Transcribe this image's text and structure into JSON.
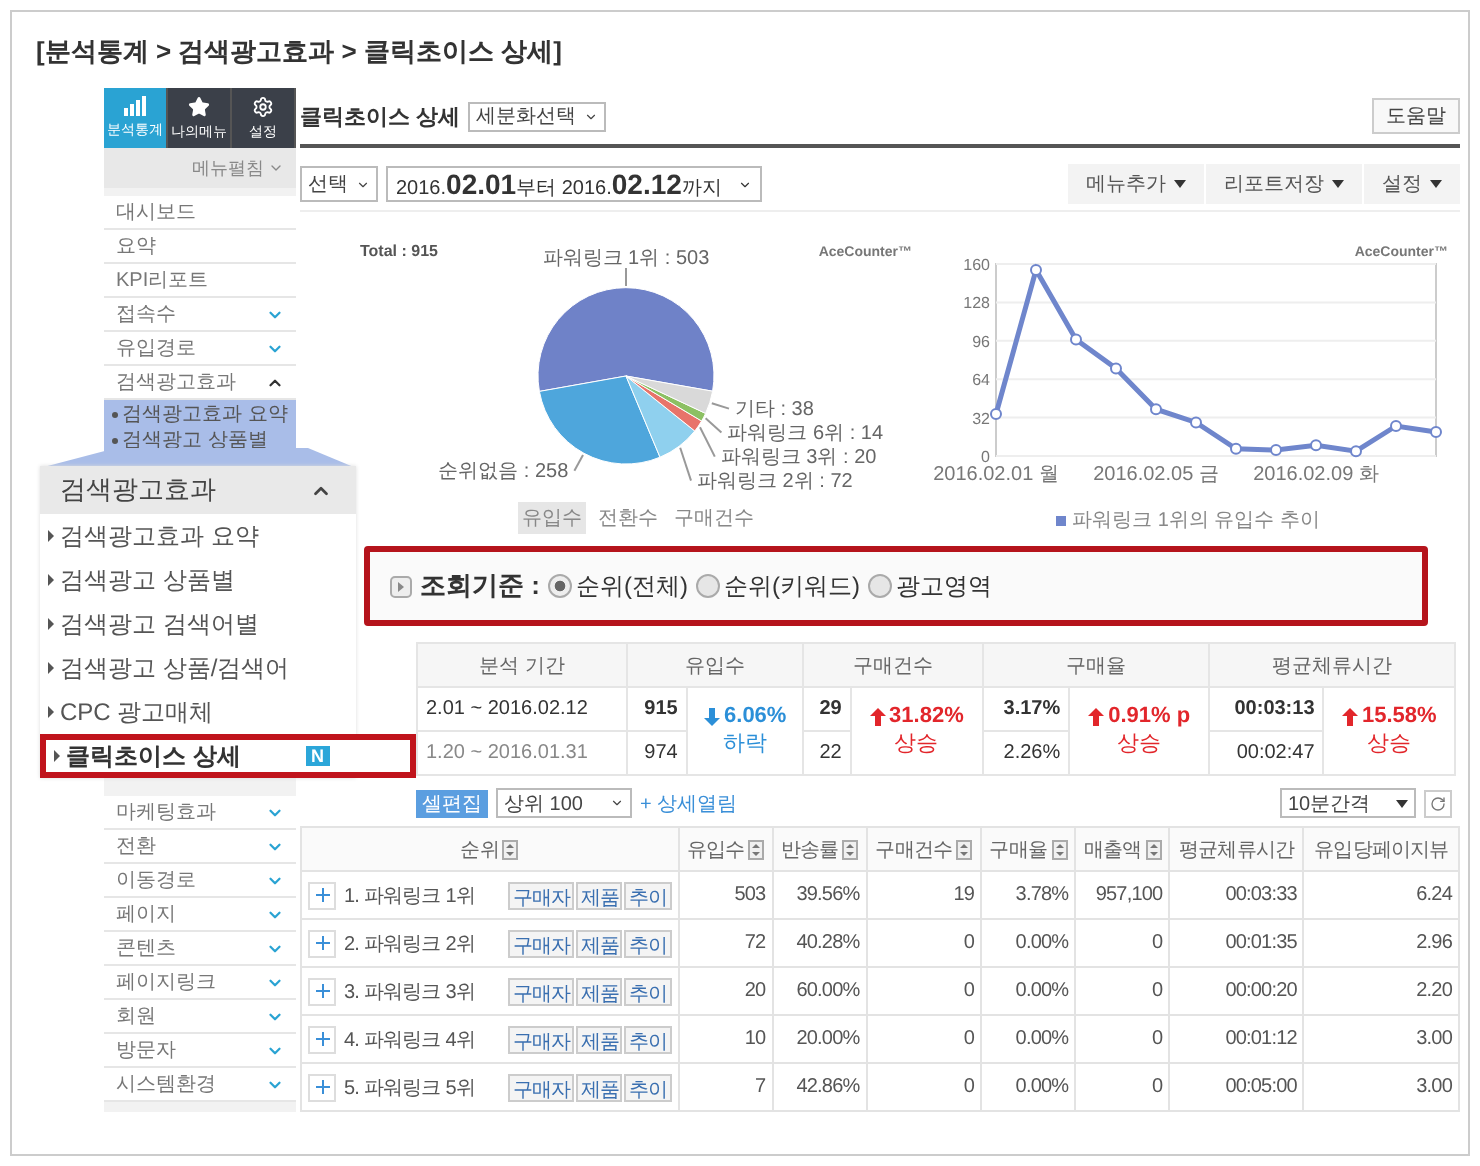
{
  "breadcrumb": "[분석통계 > 검색광고효과 > 클릭초이스 상세]",
  "sidebar": {
    "tabs": [
      {
        "label": "분석통계",
        "selected": true
      },
      {
        "label": "나의메뉴",
        "selected": false
      },
      {
        "label": "설정",
        "selected": false
      }
    ],
    "expand_all": "메뉴펼침",
    "items": [
      {
        "label": "대시보드",
        "kind": "link"
      },
      {
        "label": "요약",
        "kind": "link"
      },
      {
        "label": "KPI리포트",
        "kind": "link"
      },
      {
        "label": "접속수",
        "kind": "group",
        "expanded": false
      },
      {
        "label": "유입경로",
        "kind": "group",
        "expanded": false
      },
      {
        "label": "검색광고효과",
        "kind": "group",
        "expanded": true,
        "children": [
          "검색광고효과 요약",
          "검색광고 상품별"
        ]
      }
    ],
    "lower_items": [
      {
        "label": "마케팅효과",
        "kind": "group",
        "expanded": false
      },
      {
        "label": "전환",
        "kind": "group",
        "expanded": false
      },
      {
        "label": "이동경로",
        "kind": "group",
        "expanded": false
      },
      {
        "label": "페이지",
        "kind": "group",
        "expanded": false
      },
      {
        "label": "콘텐츠",
        "kind": "group",
        "expanded": false
      },
      {
        "label": "페이지링크",
        "kind": "group",
        "expanded": false
      },
      {
        "label": "회원",
        "kind": "group",
        "expanded": false
      },
      {
        "label": "방문자",
        "kind": "group",
        "expanded": false
      },
      {
        "label": "시스템환경",
        "kind": "group",
        "expanded": false
      }
    ]
  },
  "zoom_menu": {
    "title": "검색광고효과",
    "expanded": true,
    "items": [
      {
        "label": "검색광고효과 요약",
        "selected": false
      },
      {
        "label": "검색광고 상품별",
        "selected": false
      },
      {
        "label": "검색광고 검색어별",
        "selected": false
      },
      {
        "label": "검색광고 상품/검색어",
        "selected": false
      },
      {
        "label": "CPC 광고매체",
        "selected": false
      },
      {
        "label": "클릭초이스 상세",
        "selected": true,
        "badge": "N"
      }
    ]
  },
  "header": {
    "title": "클릭초이스 상세",
    "segment_select": "세분화선택",
    "help_button": "도움말"
  },
  "filters": {
    "period_select": "선택",
    "date_range": "2016.**02.01**부터 2016.**02.12**까지"
  },
  "toolbar": [
    "메뉴추가",
    "리포트저장",
    "설정"
  ],
  "pie": {
    "total": "Total : 915",
    "brand": "AceCounter™",
    "chart_data": {
      "type": "pie",
      "categories": [
        "파워링크 1위 : 503",
        "순위없음 : 258",
        "파워링크 2위 : 72",
        "파워링크 3위 : 20",
        "파워링크 6위 : 14",
        "기타 : 38"
      ],
      "values": [
        503,
        258,
        72,
        20,
        14,
        38
      ]
    },
    "metric_tabs": [
      {
        "label": "유입수",
        "selected": true
      },
      {
        "label": "전환수",
        "selected": false
      },
      {
        "label": "구매건수",
        "selected": false
      }
    ]
  },
  "line": {
    "brand": "AceCounter™",
    "chart_data": {
      "type": "line",
      "categories": [
        "2016.02.01 월",
        null,
        null,
        null,
        "2016.02.05 금",
        null,
        null,
        null,
        "2016.02.09 화",
        null,
        null,
        null
      ],
      "series": [
        {
          "name": "파워링크 1위의 유입수 추이",
          "color": "#6f86cc",
          "marker": true,
          "values": [
            35,
            155,
            97,
            73,
            39,
            28,
            6,
            5,
            9,
            4,
            25,
            20
          ]
        }
      ],
      "ylim": [
        0,
        160
      ],
      "yticks": [
        0,
        32,
        64,
        96,
        128,
        160
      ],
      "grid": true
    }
  },
  "criteria": {
    "label": "조회기준 :",
    "options": [
      {
        "label": "순위(전체)",
        "selected": true
      },
      {
        "label": "순위(키워드)",
        "selected": false
      },
      {
        "label": "광고영역",
        "selected": false
      }
    ]
  },
  "summary": {
    "columns": [
      "분석 기간",
      "유입수",
      "구매건수",
      "구매율",
      "평균체류시간"
    ],
    "rows": [
      {
        "period": "2.01 ~ 2016.02.12",
        "values": [
          "915",
          "29",
          "3.17%",
          "00:03:13"
        ]
      },
      {
        "period": "1.20 ~ 2016.01.31",
        "values": [
          "974",
          "22",
          "2.26%",
          "00:02:47"
        ]
      }
    ],
    "changes": [
      {
        "value": "6.06%",
        "kind": "down",
        "label": "하락"
      },
      {
        "value": "31.82%",
        "kind": "up",
        "label": "상승"
      },
      {
        "value": "0.91% p",
        "kind": "up",
        "label": "상승"
      },
      {
        "value": "15.58%",
        "kind": "up",
        "label": "상승"
      }
    ]
  },
  "table_controls": {
    "edit_button": "셀편집",
    "top_select": "상위 100",
    "expand_link": "+ 상세열림",
    "interval_select": "10분간격"
  },
  "table": {
    "columns": [
      {
        "label": "순위",
        "sortable": true
      },
      {
        "label": "유입수",
        "sortable": true
      },
      {
        "label": "반송률",
        "sortable": true
      },
      {
        "label": "구매건수",
        "sortable": true
      },
      {
        "label": "구매율",
        "sortable": true
      },
      {
        "label": "매출액",
        "sortable": true
      },
      {
        "label": "평균체류시간",
        "sortable": false
      },
      {
        "label": "유입당페이지뷰",
        "sortable": false
      }
    ],
    "rows": [
      {
        "actions": [
          "구매자",
          "제품",
          "추이"
        ],
        "cells": [
          "1.  파워링크 1위",
          "503",
          "39.56%",
          "19",
          "3.78%",
          "957,100",
          "00:03:33",
          "6.24"
        ]
      },
      {
        "actions": [
          "구매자",
          "제품",
          "추이"
        ],
        "cells": [
          "2.  파워링크 2위",
          "72",
          "40.28%",
          "0",
          "0.00%",
          "0",
          "00:01:35",
          "2.96"
        ]
      },
      {
        "actions": [
          "구매자",
          "제품",
          "추이"
        ],
        "cells": [
          "3.  파워링크 3위",
          "20",
          "60.00%",
          "0",
          "0.00%",
          "0",
          "00:00:20",
          "2.20"
        ]
      },
      {
        "actions": [
          "구매자",
          "제품",
          "추이"
        ],
        "cells": [
          "4.  파워링크 4위",
          "10",
          "20.00%",
          "0",
          "0.00%",
          "0",
          "00:01:12",
          "3.00"
        ]
      },
      {
        "actions": [
          "구매자",
          "제품",
          "추이"
        ],
        "cells": [
          "5.  파워링크 5위",
          "7",
          "42.86%",
          "0",
          "0.00%",
          "0",
          "00:05:00",
          "3.00"
        ]
      }
    ]
  }
}
